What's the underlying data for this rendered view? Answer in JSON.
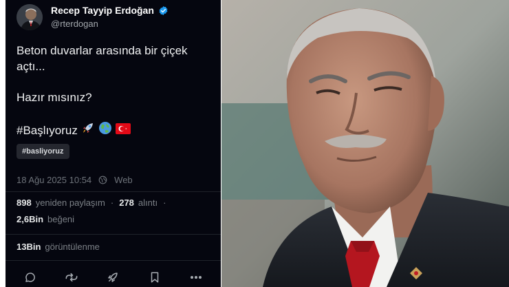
{
  "tweet": {
    "author": {
      "name": "Recep Tayyip Erdoğan",
      "handle": "@rterdogan",
      "verified_icon": "verified-badge-icon",
      "verified_color": "#1d9bf0"
    },
    "text": {
      "line1": "Beton duvarlar arasında bir çiçek açtı...",
      "line2": "Hazır mısınız?",
      "hashtag": "#Başlıyoruz",
      "emojis": [
        "rocket-emoji",
        "earth-globe-emoji",
        "turkey-flag-emoji"
      ]
    },
    "hashtag_chip": "#basliyoruz",
    "meta": {
      "timestamp": "18 Ağu 2025 10:54",
      "separator": "·",
      "source": "Web"
    },
    "stats": {
      "reposts_count": "898",
      "reposts_label": "yeniden paylaşım",
      "quotes_count": "278",
      "quotes_label": "alıntı",
      "likes_count": "2,6Bin",
      "likes_label": "beğeni",
      "views_count": "13Bin",
      "views_label": "görüntülenme",
      "separator": "·"
    },
    "actions": [
      "reply-icon",
      "repost-icon",
      "boost-rocket-icon",
      "bookmark-icon",
      "more-icon"
    ],
    "colors": {
      "background": "#05060f",
      "text": "#e7e9ea",
      "muted": "#6e737a"
    }
  },
  "photo": {
    "subject": "portrait-photo",
    "description_icon": "man-in-suit-red-tie-photo"
  }
}
